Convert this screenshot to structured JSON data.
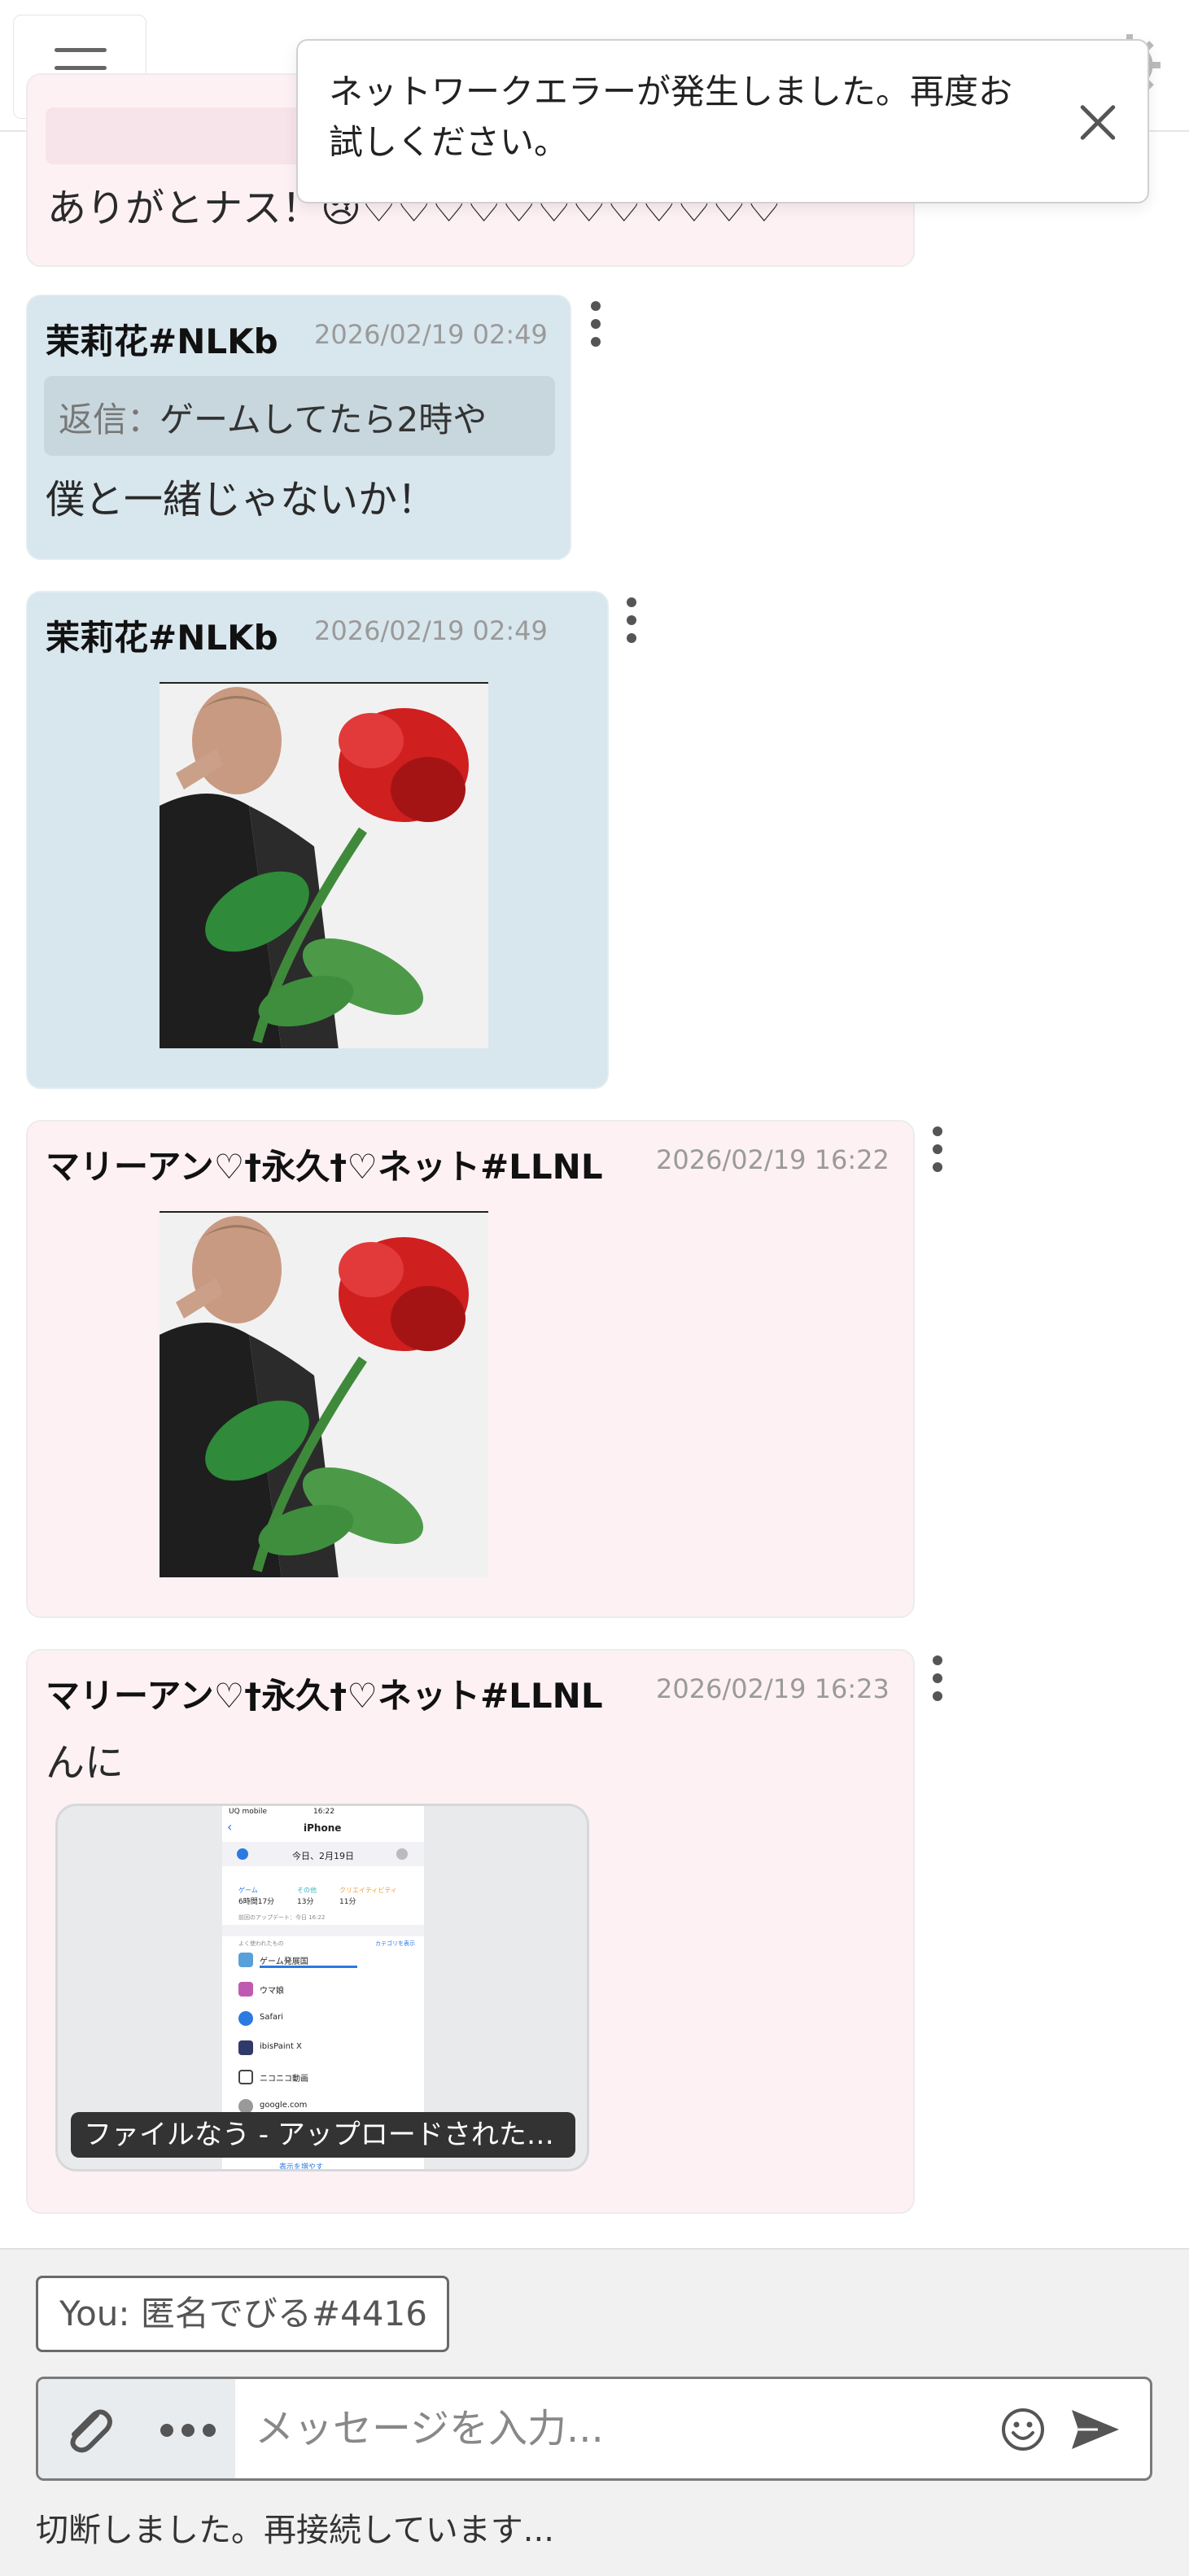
{
  "toast": {
    "message": "ネットワークエラーが発生しました。再度お試しください。",
    "close_icon": "close-icon"
  },
  "header": {
    "menu_icon": "hamburger-icon",
    "right_icons": [
      "user-icon",
      "bell-icon",
      "settings-icon"
    ]
  },
  "messages": [
    {
      "text": "ありがとナス！😢♡♡♡♡♡♡♡♡♡♡♡♡"
    },
    {
      "author": "茉莉花#NLKb",
      "time": "2026/02/19 02:49",
      "reply_label": "返信：",
      "reply_text": "ゲームしてたら2時や",
      "text": "僕と一緒じゃないか！"
    },
    {
      "author": "茉莉花#NLKb",
      "time": "2026/02/19 02:49",
      "image": "man-with-rose-image"
    },
    {
      "author": "マリーアン♡†永久†♡ネット#LLNL",
      "time": "2026/02/19 16:22",
      "image": "man-with-rose-image"
    },
    {
      "author": "マリーアン♡†永久†♡ネット#LLNL",
      "time": "2026/02/19 16:23",
      "text": "んに",
      "attachment": {
        "caption": "ファイルなう - アップロードされたファイル",
        "phone": {
          "carrier": "UQ mobile",
          "clock": "16:22",
          "title": "iPhone",
          "date": "今日、2月19日",
          "stats": [
            {
              "label": "ゲーム",
              "value": "6時間17分"
            },
            {
              "label": "その他",
              "value": "13分"
            },
            {
              "label": "クリエイティビティ",
              "value": "11分"
            }
          ],
          "updated": "前回のアップデート：今日 16:22",
          "section": "よく使われたもの",
          "section_link": "カテゴリを表示",
          "apps": [
            "ゲーム発展国",
            "ウマ娘",
            "Safari",
            "ibisPaint X",
            "ニコニコ動画",
            "google.com"
          ],
          "more": "表示を増やす"
        }
      }
    }
  ],
  "composer": {
    "identity": "You: 匿名でびる#4416",
    "placeholder": "メッセージを入力...",
    "attach_icon": "paperclip-icon",
    "more_icon": "more-icon",
    "emoji_icon": "emoji-icon",
    "send_icon": "send-icon"
  },
  "status": "切断しました。再接続しています..."
}
